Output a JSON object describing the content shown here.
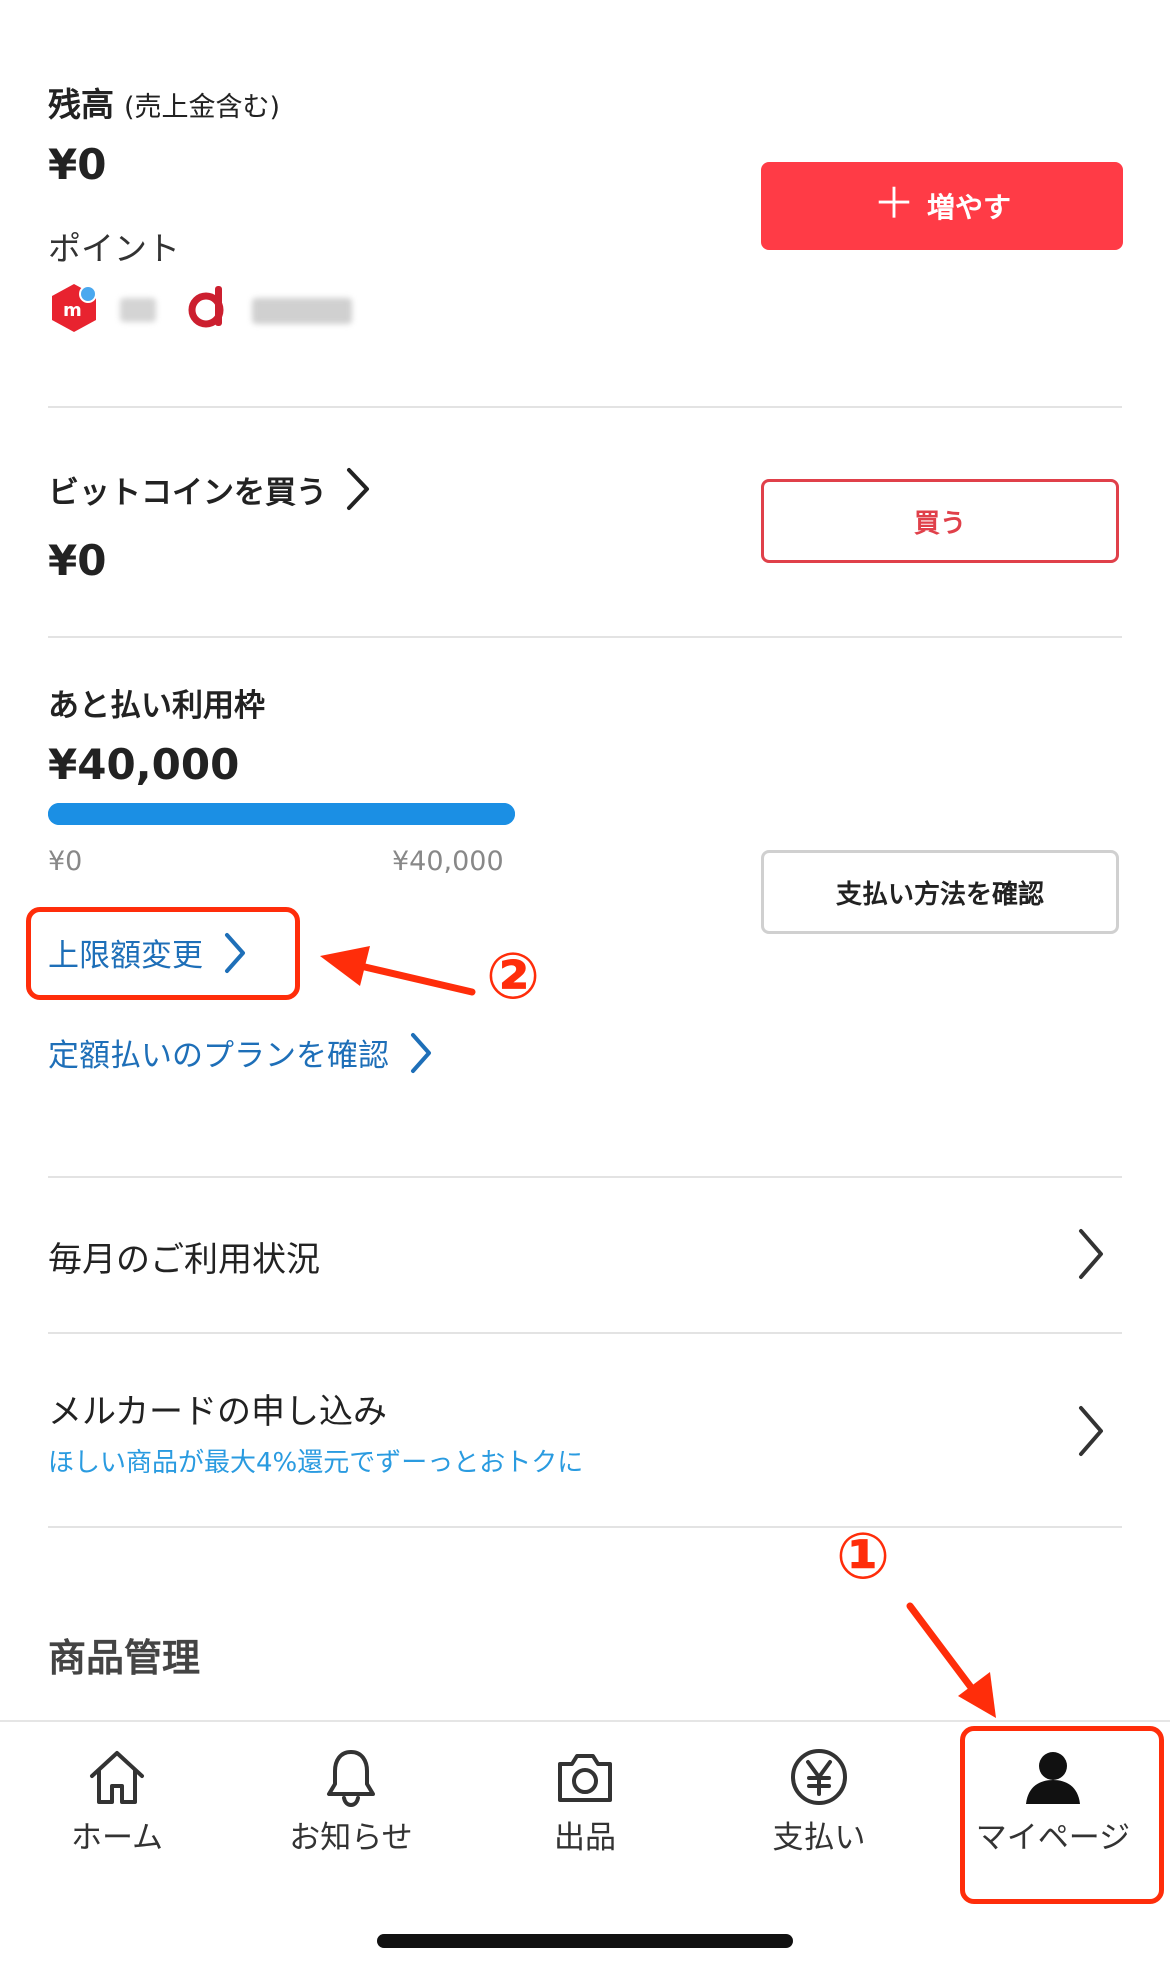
{
  "balance": {
    "title": "残高",
    "subtitle": "(売上金含む)",
    "amount": "¥0",
    "increase_button": "増やす",
    "points_label": "ポイント"
  },
  "bitcoin": {
    "title": "ビットコインを買う",
    "amount": "¥0",
    "buy_button": "買う"
  },
  "atobarai": {
    "title": "あと払い利用枠",
    "amount": "¥40,000",
    "bar_min": "¥0",
    "bar_max": "¥40,000",
    "usage_fraction": 1.0,
    "pay_button": "支払い方法を確認",
    "limit_link": "上限額変更",
    "plan_link": "定額払いのプランを確認"
  },
  "annotations": {
    "step1": "①",
    "step2": "②",
    "color": "#ff2d0a"
  },
  "list": {
    "usage": "毎月のご利用状況",
    "card_title": "メルカードの申し込み",
    "card_sub": "ほしい商品が最大4%還元でずーっとおトクに"
  },
  "section_heading": "商品管理",
  "tabs": [
    {
      "label": "ホーム",
      "icon": "home-icon"
    },
    {
      "label": "お知らせ",
      "icon": "bell-icon"
    },
    {
      "label": "出品",
      "icon": "camera-icon"
    },
    {
      "label": "支払い",
      "icon": "yen-icon"
    },
    {
      "label": "マイページ",
      "icon": "person-icon"
    }
  ],
  "colors": {
    "accent_red": "#ff3b46",
    "link_blue": "#1e6fb8",
    "progress_blue": "#1b8fe4"
  }
}
